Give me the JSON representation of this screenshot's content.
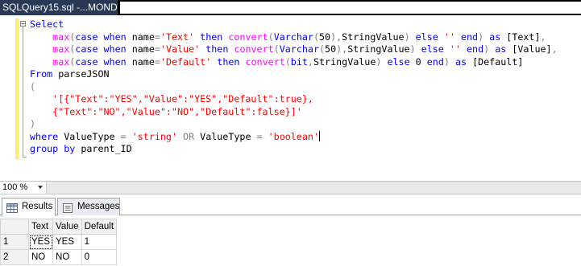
{
  "window": {
    "tab_title": "SQLQuery15.sql -...MOND\\"
  },
  "editor": {
    "outline_glyph": "−",
    "lines": [
      [
        {
          "t": "Select",
          "c": "kw"
        }
      ],
      [
        {
          "t": "    ",
          "c": "bk"
        },
        {
          "t": "max",
          "c": "fn"
        },
        {
          "t": "(",
          "c": "gr"
        },
        {
          "t": "case when",
          "c": "kw"
        },
        {
          "t": " name",
          "c": "bk"
        },
        {
          "t": "=",
          "c": "gr"
        },
        {
          "t": "'Text'",
          "c": "str"
        },
        {
          "t": " then ",
          "c": "kw"
        },
        {
          "t": "convert",
          "c": "fn"
        },
        {
          "t": "(",
          "c": "gr"
        },
        {
          "t": "Varchar",
          "c": "kw"
        },
        {
          "t": "(",
          "c": "gr"
        },
        {
          "t": "50",
          "c": "bk"
        },
        {
          "t": "),",
          "c": "gr"
        },
        {
          "t": "StringValue",
          "c": "bk"
        },
        {
          "t": ")",
          "c": "gr"
        },
        {
          "t": " else ",
          "c": "kw"
        },
        {
          "t": "''",
          "c": "str"
        },
        {
          "t": " end",
          "c": "kw"
        },
        {
          "t": ")",
          "c": "gr"
        },
        {
          "t": " as ",
          "c": "kw"
        },
        {
          "t": "[Text]",
          "c": "bk"
        },
        {
          "t": ",",
          "c": "gr"
        }
      ],
      [
        {
          "t": "    ",
          "c": "bk"
        },
        {
          "t": "max",
          "c": "fn"
        },
        {
          "t": "(",
          "c": "gr"
        },
        {
          "t": "case when",
          "c": "kw"
        },
        {
          "t": " name",
          "c": "bk"
        },
        {
          "t": "=",
          "c": "gr"
        },
        {
          "t": "'Value'",
          "c": "str"
        },
        {
          "t": " then ",
          "c": "kw"
        },
        {
          "t": "convert",
          "c": "fn"
        },
        {
          "t": "(",
          "c": "gr"
        },
        {
          "t": "Varchar",
          "c": "kw"
        },
        {
          "t": "(",
          "c": "gr"
        },
        {
          "t": "50",
          "c": "bk"
        },
        {
          "t": "),",
          "c": "gr"
        },
        {
          "t": "StringValue",
          "c": "bk"
        },
        {
          "t": ")",
          "c": "gr"
        },
        {
          "t": " else ",
          "c": "kw"
        },
        {
          "t": "''",
          "c": "str"
        },
        {
          "t": " end",
          "c": "kw"
        },
        {
          "t": ")",
          "c": "gr"
        },
        {
          "t": " as ",
          "c": "kw"
        },
        {
          "t": "[Value]",
          "c": "bk"
        },
        {
          "t": ",",
          "c": "gr"
        }
      ],
      [
        {
          "t": "    ",
          "c": "bk"
        },
        {
          "t": "max",
          "c": "fn"
        },
        {
          "t": "(",
          "c": "gr"
        },
        {
          "t": "case when",
          "c": "kw"
        },
        {
          "t": " name",
          "c": "bk"
        },
        {
          "t": "=",
          "c": "gr"
        },
        {
          "t": "'Default'",
          "c": "str"
        },
        {
          "t": " then ",
          "c": "kw"
        },
        {
          "t": "convert",
          "c": "fn"
        },
        {
          "t": "(",
          "c": "gr"
        },
        {
          "t": "bit",
          "c": "kw"
        },
        {
          "t": ",",
          "c": "gr"
        },
        {
          "t": "StringValue",
          "c": "bk"
        },
        {
          "t": ")",
          "c": "gr"
        },
        {
          "t": " else ",
          "c": "kw"
        },
        {
          "t": "0",
          "c": "bk"
        },
        {
          "t": " end",
          "c": "kw"
        },
        {
          "t": ")",
          "c": "gr"
        },
        {
          "t": " as ",
          "c": "kw"
        },
        {
          "t": "[Default]",
          "c": "bk"
        }
      ],
      [
        {
          "t": "From ",
          "c": "kw"
        },
        {
          "t": "parseJSON",
          "c": "bk"
        }
      ],
      [
        {
          "t": "(",
          "c": "gr"
        }
      ],
      [
        {
          "t": "    ",
          "c": "bk"
        },
        {
          "t": "'[{\"Text\":\"YES\",\"Value\":\"YES\",\"Default\":true},",
          "c": "str"
        }
      ],
      [
        {
          "t": "    ",
          "c": "bk"
        },
        {
          "t": "{\"Text\":\"NO\",\"Value\":\"NO\",\"Default\":false}]'",
          "c": "str"
        }
      ],
      [
        {
          "t": ")",
          "c": "gr"
        }
      ],
      [
        {
          "t": "where ",
          "c": "kw"
        },
        {
          "t": "ValueType ",
          "c": "bk"
        },
        {
          "t": "=",
          "c": "gr"
        },
        {
          "t": " ",
          "c": "bk"
        },
        {
          "t": "'string'",
          "c": "str"
        },
        {
          "t": " OR ",
          "c": "gr"
        },
        {
          "t": "ValueType ",
          "c": "bk"
        },
        {
          "t": "=",
          "c": "gr"
        },
        {
          "t": " ",
          "c": "bk"
        },
        {
          "t": "'boolean'",
          "c": "str"
        },
        {
          "t": "",
          "c": "caret"
        }
      ],
      [
        {
          "t": "group by ",
          "c": "kw"
        },
        {
          "t": "parent_ID",
          "c": "bk"
        }
      ]
    ]
  },
  "zoom": {
    "value": "100 %"
  },
  "result_tabs": [
    {
      "label": "Results",
      "icon": "grid-icon",
      "active": true
    },
    {
      "label": "Messages",
      "icon": "messages-icon",
      "active": false
    }
  ],
  "results": {
    "columns": [
      "Text",
      "Value",
      "Default"
    ],
    "rows": [
      {
        "num": "1",
        "cells": [
          "YES",
          "YES",
          "1"
        ]
      },
      {
        "num": "2",
        "cells": [
          "NO",
          "NO",
          "0"
        ]
      }
    ]
  }
}
